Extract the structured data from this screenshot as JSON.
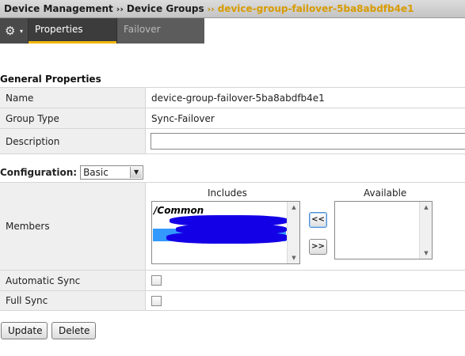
{
  "breadcrumb": {
    "items": [
      "Device Management",
      "Device Groups"
    ],
    "separator": "››",
    "current": "device-group-failover-5ba8abdfb4e1"
  },
  "tabs": {
    "gear_icon": "⚙",
    "gear_caret": "▾",
    "items": [
      {
        "label": "Properties",
        "active": true
      },
      {
        "label": "Failover",
        "active": false
      }
    ]
  },
  "general": {
    "section_title": "General Properties",
    "name_label": "Name",
    "name_value": "device-group-failover-5ba8abdfb4e1",
    "group_type_label": "Group Type",
    "group_type_value": "Sync-Failover",
    "description_label": "Description",
    "description_value": ""
  },
  "configuration": {
    "label": "Configuration:",
    "selected": "Basic"
  },
  "members": {
    "label": "Members",
    "includes_caption": "Includes",
    "available_caption": "Available",
    "includes_group": "/Common",
    "move_left_label": "<<",
    "move_right_label": ">>",
    "scroll_up_icon": "▲",
    "scroll_down_icon": "▼"
  },
  "sync": {
    "automatic_label": "Automatic Sync",
    "automatic_checked": false,
    "full_label": "Full Sync",
    "full_checked": false
  },
  "actions": {
    "update_label": "Update",
    "delete_label": "Delete"
  },
  "colors": {
    "accent": "#f2b705",
    "breadcrumb_current": "#d89b00",
    "selection": "#3399ff",
    "redaction": "#1400e6"
  }
}
